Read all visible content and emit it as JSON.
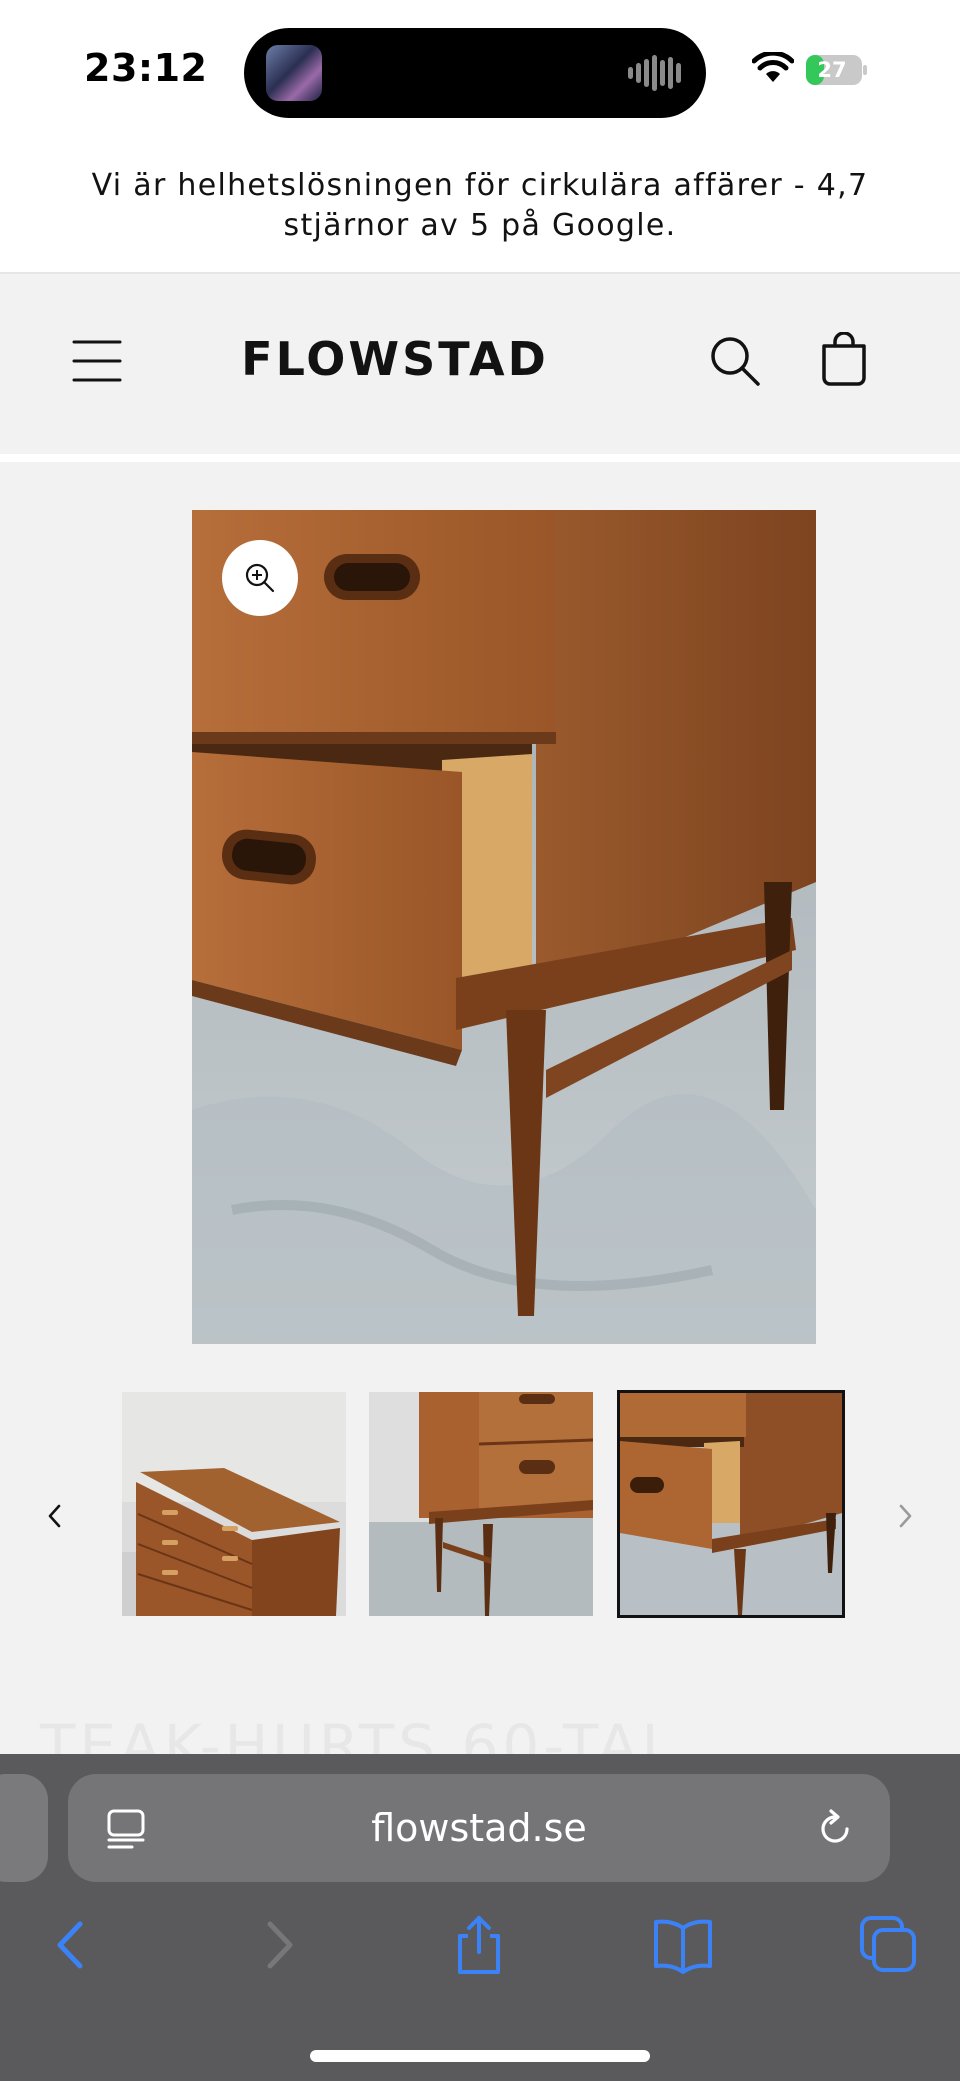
{
  "status_bar": {
    "time": "23:12",
    "battery": "27"
  },
  "announcement": "Vi är helhetslösningen för cirkulära affärer - 4,7 stjärnor av 5 på Google.",
  "header": {
    "logo": "FLOWSTAD"
  },
  "gallery": {
    "title_peek": "TEAK-HURTS 60-TAL"
  },
  "browser": {
    "url": "flowstad.se"
  },
  "colors": {
    "accent": "#3b82f6",
    "toolbar": "#5a5a5c"
  }
}
